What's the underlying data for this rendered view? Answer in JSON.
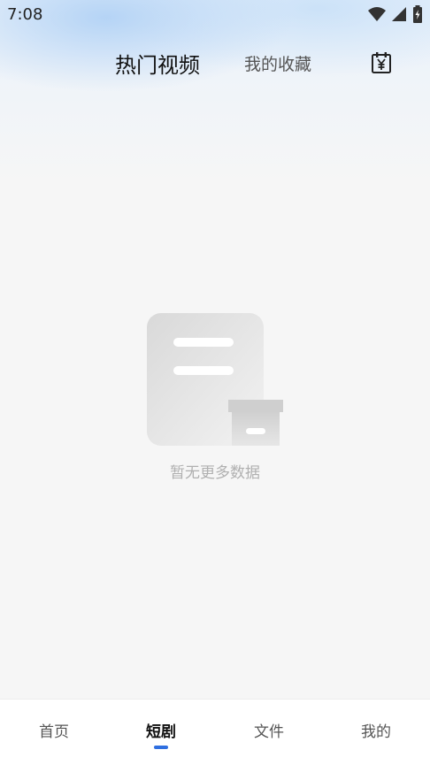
{
  "status_bar": {
    "time": "7:08"
  },
  "header": {
    "tabs": [
      {
        "label": "热门视频",
        "active": true
      },
      {
        "label": "我的收藏",
        "active": false
      }
    ],
    "calendar_icon": "calendar-yen-icon"
  },
  "empty_state": {
    "message": "暂无更多数据"
  },
  "bottom_nav": {
    "items": [
      {
        "label": "首页",
        "active": false
      },
      {
        "label": "短剧",
        "active": true
      },
      {
        "label": "文件",
        "active": false
      },
      {
        "label": "我的",
        "active": false
      }
    ],
    "accent_color": "#2f6fe0"
  }
}
